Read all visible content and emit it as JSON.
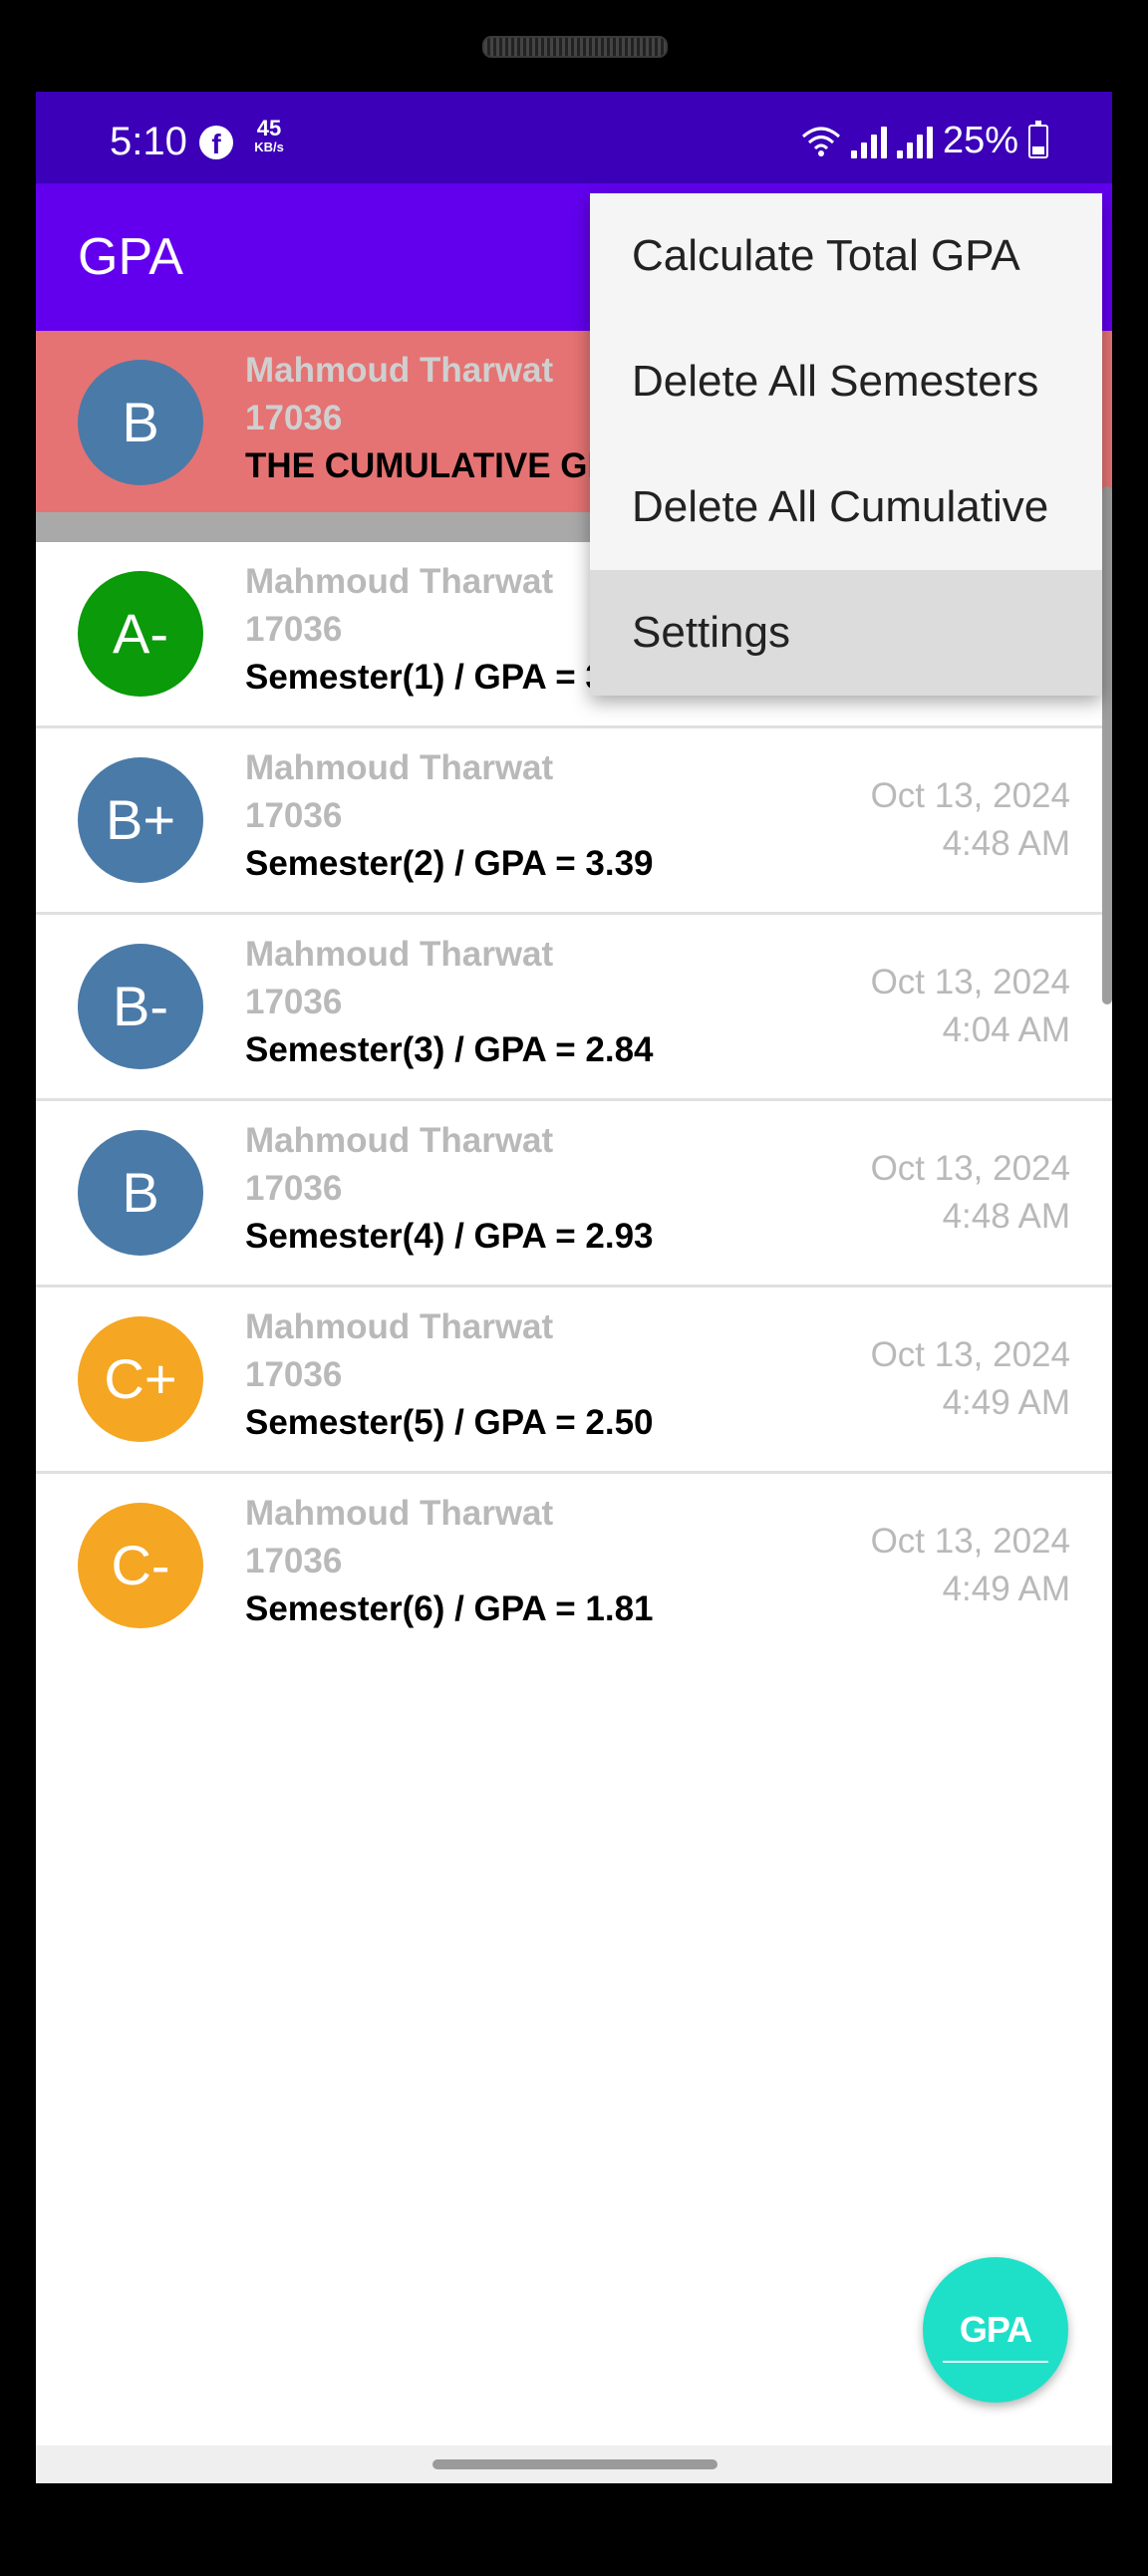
{
  "status_bar": {
    "time": "5:10",
    "net_speed": "45",
    "net_unit": "KB/s",
    "battery": "25%",
    "icons": [
      "facebook-icon",
      "wifi-icon",
      "signal-icon",
      "battery-icon"
    ]
  },
  "app_bar": {
    "title": "GPA",
    "color": "#6200ee"
  },
  "menu": {
    "items": [
      {
        "label": "Calculate Total GPA"
      },
      {
        "label": "Delete All Semesters"
      },
      {
        "label": "Delete All Cumulative"
      },
      {
        "label": "Settings",
        "selected": true
      }
    ]
  },
  "cumulative": {
    "grade": "B",
    "name": "Mahmoud Tharwat",
    "id": "17036",
    "title": "THE CUMULATIVE GP",
    "avatar_color": "#4a7aa8",
    "row_color": "#e57373"
  },
  "semesters": [
    {
      "grade": "A-",
      "name": "Mahmoud Tharwat",
      "id": "17036",
      "gpa": "Semester(1) / GPA = 3.",
      "date": "",
      "time": "",
      "color": "#0a9a0a"
    },
    {
      "grade": "B+",
      "name": "Mahmoud Tharwat",
      "id": "17036",
      "gpa": "Semester(2) / GPA = 3.39",
      "date": "Oct 13, 2024",
      "time": "4:48 AM",
      "color": "#4a7aa8"
    },
    {
      "grade": "B-",
      "name": "Mahmoud Tharwat",
      "id": "17036",
      "gpa": "Semester(3) / GPA = 2.84",
      "date": "Oct 13, 2024",
      "time": "4:04 AM",
      "color": "#4a7aa8"
    },
    {
      "grade": "B",
      "name": "Mahmoud Tharwat",
      "id": "17036",
      "gpa": "Semester(4) / GPA = 2.93",
      "date": "Oct 13, 2024",
      "time": "4:48 AM",
      "color": "#4a7aa8"
    },
    {
      "grade": "C+",
      "name": "Mahmoud Tharwat",
      "id": "17036",
      "gpa": "Semester(5) / GPA = 2.50",
      "date": "Oct 13, 2024",
      "time": "4:49 AM",
      "color": "#f5a623"
    },
    {
      "grade": "C-",
      "name": "Mahmoud Tharwat",
      "id": "17036",
      "gpa": "Semester(6) / GPA = 1.81",
      "date": "Oct 13, 2024",
      "time": "4:49 AM",
      "color": "#f5a623"
    }
  ],
  "fab": {
    "label": "GPA",
    "color": "#1ee0c8"
  }
}
